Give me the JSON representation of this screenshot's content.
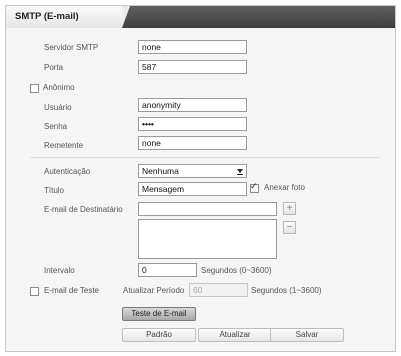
{
  "tab": {
    "title": "SMTP (E-mail)"
  },
  "fields": {
    "server": {
      "label": "Servidor SMTP",
      "value": "none"
    },
    "port": {
      "label": "Porta",
      "value": "587"
    },
    "anonymous": {
      "label": "Anônimo",
      "checked": false
    },
    "user": {
      "label": "Usuário",
      "value": "anonymity"
    },
    "password": {
      "label": "Senha",
      "value": "••••"
    },
    "sender": {
      "label": "Remetente",
      "value": "none"
    },
    "auth": {
      "label": "Autenticação",
      "value": "Nenhuma"
    },
    "subject": {
      "label": "Título",
      "value": "Mensagem"
    },
    "attach": {
      "label": "Anexar foto",
      "checked": true
    },
    "recipient": {
      "label": "E-mail de Destinatário",
      "value": "",
      "add": "+",
      "remove": "−"
    },
    "interval": {
      "label": "Intervalo",
      "value": "0",
      "unit": "Segundos (0~3600)"
    },
    "test_email": {
      "label": "E-mail de Teste",
      "checked": false
    },
    "update_period": {
      "label": "Atualizar Período",
      "value": "60",
      "unit": "Segundos (1~3600)"
    }
  },
  "buttons": {
    "test": "Teste de E-mail",
    "default": "Padrão",
    "refresh": "Atualizar",
    "save": "Salvar"
  },
  "icons": {
    "dropdown": "chevron-down-icon",
    "add": "plus-icon",
    "remove": "minus-icon",
    "check": "check-icon"
  }
}
